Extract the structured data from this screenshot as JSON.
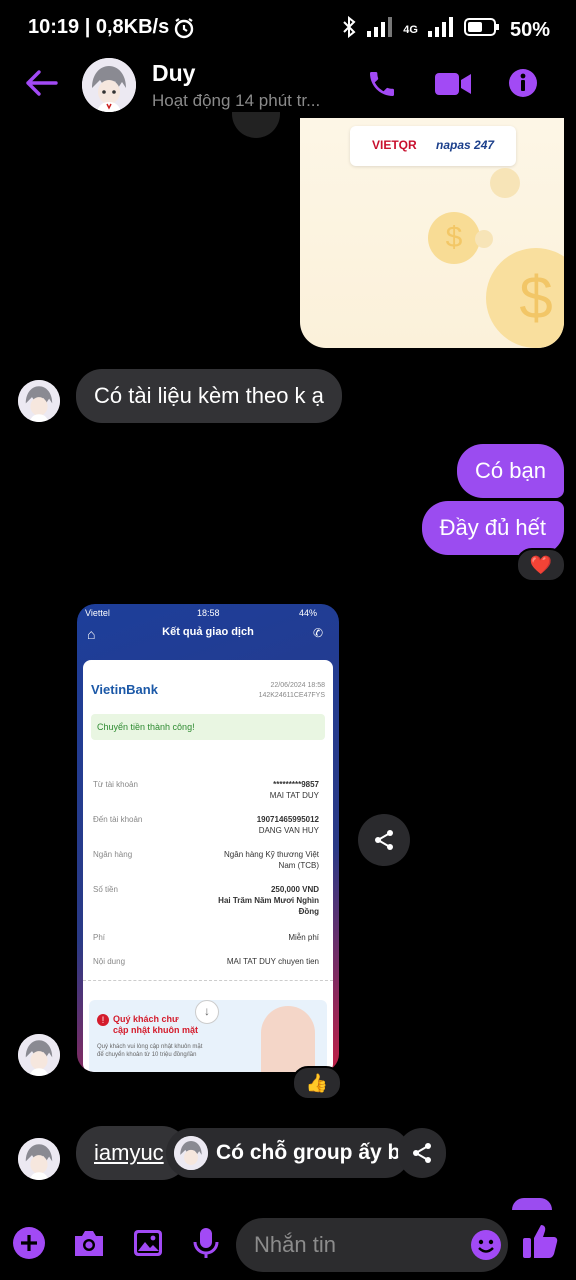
{
  "status": {
    "time": "10:19 | 0,8KB/s",
    "network": "4G",
    "battery": "50%"
  },
  "header": {
    "name": "Duy",
    "activity": "Hoạt động 14 phút tr..."
  },
  "top_image": {
    "brand1": "VIETQR",
    "brand2": "napas 247"
  },
  "messages": {
    "in1": "Có tài liệu kèm theo k ạ",
    "out1": "Có bạn",
    "out2": "Đầy đủ hết",
    "out2_reaction": "❤️",
    "receipt_reaction": "👍",
    "link_text": "iamyuc",
    "reply_preview": "Có chỗ group ấy b"
  },
  "receipt": {
    "carrier": "Viettel",
    "time": "18:58",
    "battery": "44%",
    "title": "Kết quả giao dịch",
    "bank": "VietinBank",
    "date": "22/06/2024 18:58",
    "ref": "142K24611CE47FYS",
    "status": "Chuyển tiền thành công!",
    "rows": [
      {
        "label": "Từ tài khoản",
        "value": "*********9857",
        "sub": "MAI TAT DUY"
      },
      {
        "label": "Đến tài khoản",
        "value": "19071465995012",
        "sub": "DANG VAN HUY"
      },
      {
        "label": "Ngân hàng",
        "value": "Ngân hàng Kỹ thương Việt",
        "sub": "Nam (TCB)"
      },
      {
        "label": "Số tiền",
        "value": "250,000 VND",
        "sub": "Hai Trăm Năm Mươi Nghìn",
        "sub2": "Đồng"
      },
      {
        "label": "Phí",
        "value": "Miễn phí",
        "sub": ""
      },
      {
        "label": "Nội dung",
        "value": "MAI TAT DUY chuyen tien",
        "sub": ""
      }
    ],
    "promo_title": "Quý khách chư",
    "promo_title2": "cập nhật khuôn mặt",
    "promo_text": "Quý khách vui lòng cập nhật khuôn mặt",
    "promo_text2": "để chuyển khoản từ 10 triệu đồng/lần"
  },
  "composer": {
    "placeholder": "Nhắn tin"
  },
  "colors": {
    "accent": "#9b4cf0",
    "incoming": "#333336"
  }
}
